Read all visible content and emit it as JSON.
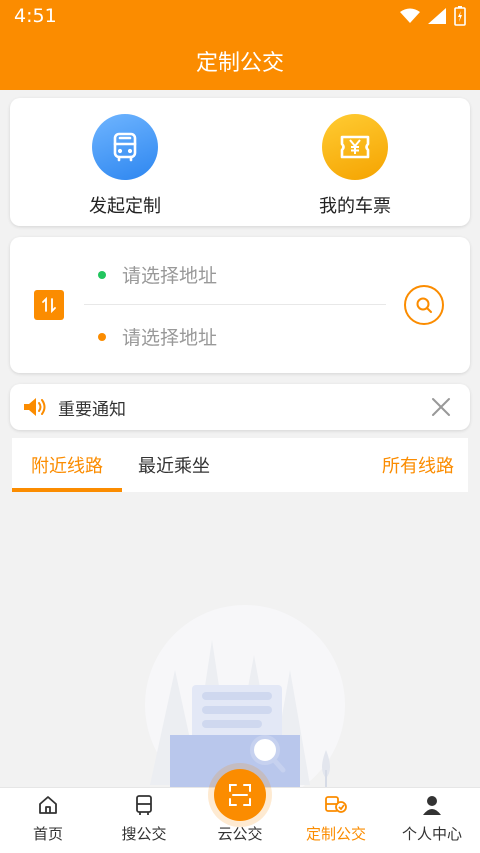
{
  "status_bar": {
    "time": "4:51"
  },
  "header": {
    "title": "定制公交"
  },
  "quick_actions": {
    "launch_custom": {
      "label": "发起定制",
      "icon": "bus-icon"
    },
    "my_tickets": {
      "label": "我的车票",
      "icon": "ticket-icon"
    }
  },
  "route": {
    "from_placeholder": "请选择地址",
    "to_placeholder": "请选择地址"
  },
  "notice": {
    "text": "重要通知"
  },
  "tabs": {
    "nearby": "附近线路",
    "recent": "最近乘坐",
    "all": "所有线路"
  },
  "bottom_nav": {
    "items": [
      {
        "label": "首页",
        "icon": "home-icon"
      },
      {
        "label": "搜公交",
        "icon": "bus-icon"
      },
      {
        "label": "云公交",
        "icon": "scan-icon"
      },
      {
        "label": "定制公交",
        "icon": "custom-bus-icon"
      },
      {
        "label": "个人中心",
        "icon": "person-icon"
      }
    ]
  },
  "colors": {
    "primary": "#fb8c00",
    "accent_blue": "#2d86f0",
    "accent_gold": "#f5a300"
  }
}
